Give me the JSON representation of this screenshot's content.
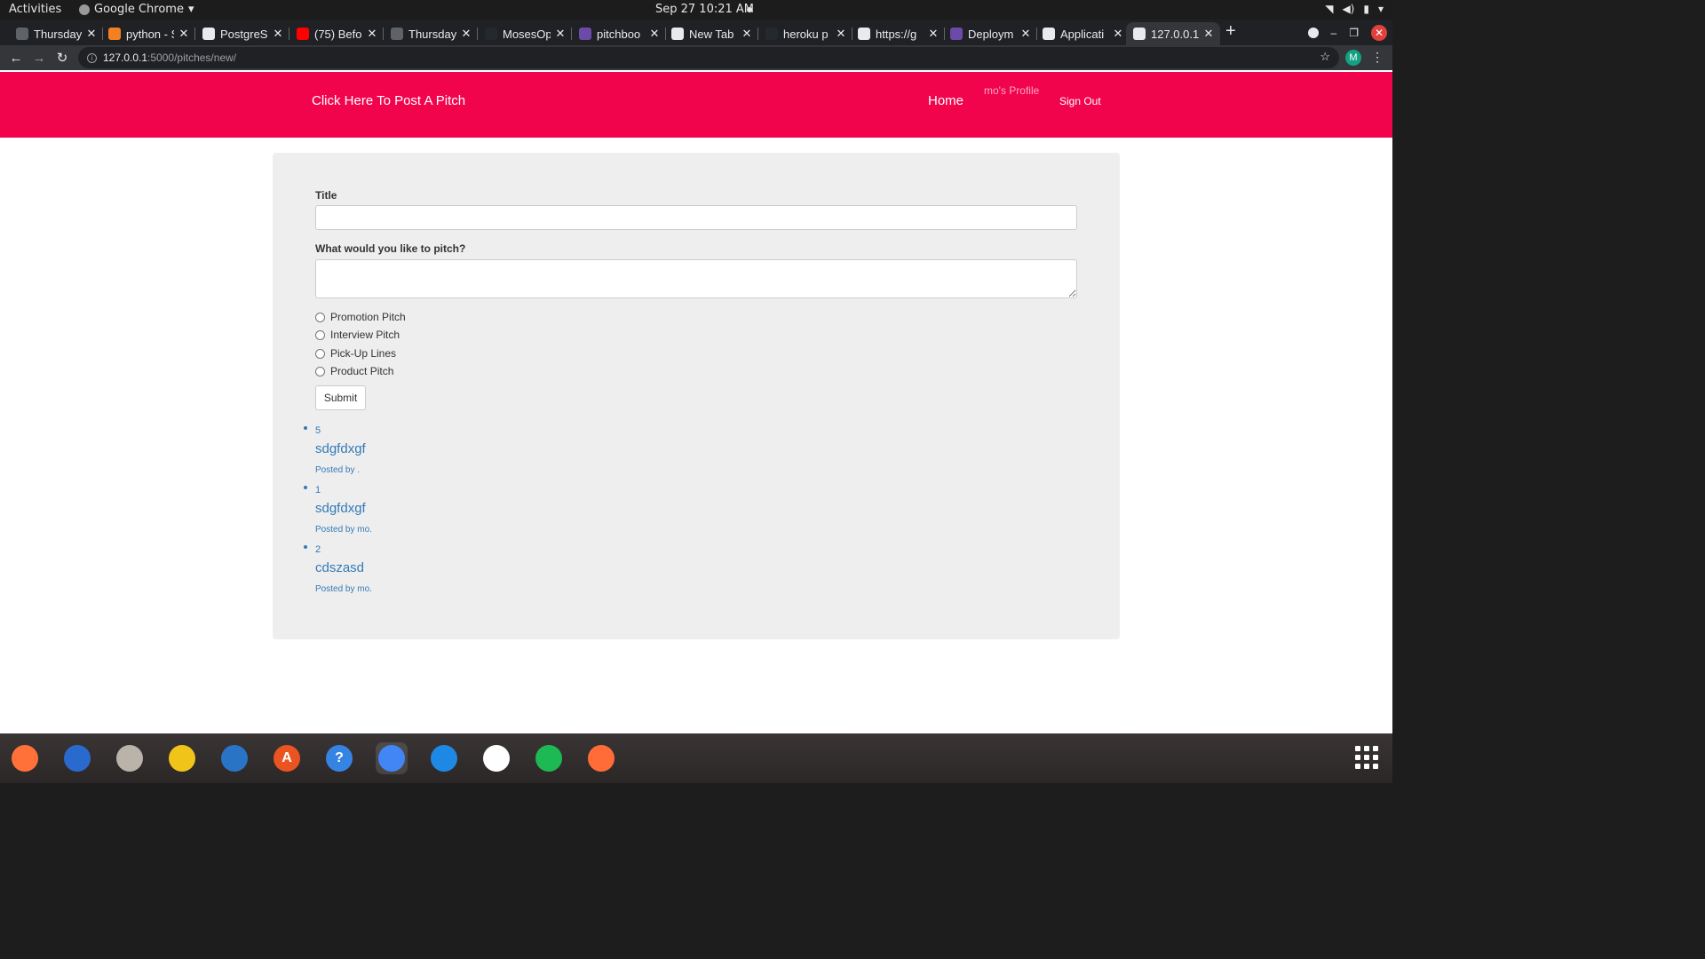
{
  "topbar": {
    "activities": "Activities",
    "app_name": "Google Chrome",
    "clock": "Sep 27  10:21 AM"
  },
  "tabs": [
    {
      "label": "Thursday",
      "fav_color": "#5f6368"
    },
    {
      "label": "python - S",
      "fav_color": "#f48024"
    },
    {
      "label": "PostgreS",
      "fav_color": "#e8eaed"
    },
    {
      "label": "(75) Befo",
      "fav_color": "#ff0000"
    },
    {
      "label": "Thursday",
      "fav_color": "#5f6368"
    },
    {
      "label": "MosesOp",
      "fav_color": "#24292e"
    },
    {
      "label": "pitchboo",
      "fav_color": "#6c4ba8"
    },
    {
      "label": "New Tab",
      "fav_color": "#e8eaed"
    },
    {
      "label": "heroku p",
      "fav_color": "#24292e"
    },
    {
      "label": "https://g",
      "fav_color": "#e8eaed"
    },
    {
      "label": "Deploym",
      "fav_color": "#6c4ba8"
    },
    {
      "label": "Applicati",
      "fav_color": "#e8eaed"
    },
    {
      "label": "127.0.0.1:",
      "fav_color": "#e8eaed"
    }
  ],
  "omnibox": {
    "host": "127.0.0.1",
    "path": ":5000/pitches/new/"
  },
  "profile_initial": "M",
  "navbar": {
    "post_link": "Click Here To Post A Pitch",
    "home": "Home",
    "profile": "mo's Profile",
    "sign_out": "Sign Out",
    "color": "#f2044d"
  },
  "form": {
    "title_label": "Title",
    "title_value": "",
    "pitch_label": "What would you like to pitch?",
    "pitch_value": "",
    "categories": [
      "Promotion Pitch",
      "Interview Pitch",
      "Pick-Up Lines",
      "Product Pitch"
    ],
    "submit": "Submit"
  },
  "pitches": [
    {
      "number": "5",
      "title": "sdgfdxgf",
      "posted_by": "Posted by ."
    },
    {
      "number": "1",
      "title": "sdgfdxgf",
      "posted_by": "Posted by mo."
    },
    {
      "number": "2",
      "title": "cdszasd",
      "posted_by": "Posted by mo."
    }
  ],
  "dock": [
    {
      "name": "firefox-icon",
      "color": "#ff7139",
      "glyph": ""
    },
    {
      "name": "thunderbird-icon",
      "color": "#2a6acf",
      "glyph": ""
    },
    {
      "name": "files-icon",
      "color": "#b9b3a9",
      "glyph": ""
    },
    {
      "name": "rhythmbox-icon",
      "color": "#f0c419",
      "glyph": ""
    },
    {
      "name": "writer-icon",
      "color": "#2a74c8",
      "glyph": ""
    },
    {
      "name": "software-icon",
      "color": "#e95420",
      "glyph": "A"
    },
    {
      "name": "help-icon",
      "color": "#3584e4",
      "glyph": "?"
    },
    {
      "name": "chrome-icon",
      "color": "#4285f4",
      "glyph": ""
    },
    {
      "name": "vscode-icon",
      "color": "#1e88e5",
      "glyph": ""
    },
    {
      "name": "slack-icon",
      "color": "#ffffff",
      "glyph": ""
    },
    {
      "name": "spotify-icon",
      "color": "#1db954",
      "glyph": ""
    },
    {
      "name": "postman-icon",
      "color": "#ff6c37",
      "glyph": ""
    }
  ]
}
